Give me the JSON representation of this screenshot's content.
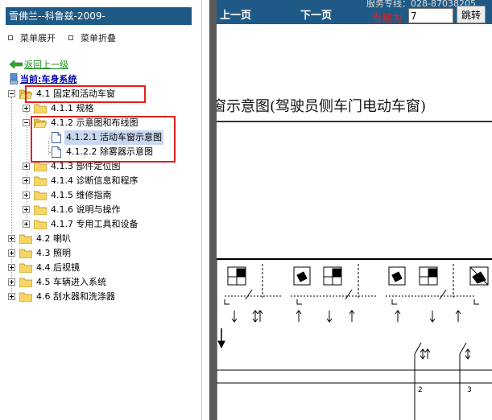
{
  "left_panel": {
    "title": "雪佛兰--科鲁兹-2009-",
    "expand_label": "菜单展开",
    "collapse_label": "菜单折叠",
    "back_label": "返回上一级",
    "current_label": "当前:车身系统",
    "tree": [
      {
        "level": 0,
        "label": "4.1 固定和活动车窗",
        "type": "folder",
        "toggle": "minus"
      },
      {
        "level": 1,
        "label": "4.1.1 规格",
        "type": "folder",
        "toggle": "plus"
      },
      {
        "level": 1,
        "label": "4.1.2 示意图和布线图",
        "type": "folder",
        "toggle": "minus"
      },
      {
        "level": 2,
        "label": "4.1.2.1 活动车窗示意图",
        "type": "doc",
        "selected": true
      },
      {
        "level": 2,
        "label": "4.1.2.2 除雾器示意图",
        "type": "doc"
      },
      {
        "level": 1,
        "label": "4.1.3 部件定位图",
        "type": "folder",
        "toggle": "plus"
      },
      {
        "level": 1,
        "label": "4.1.4 诊断信息和程序",
        "type": "folder",
        "toggle": "plus"
      },
      {
        "level": 1,
        "label": "4.1.5 维修指南",
        "type": "folder",
        "toggle": "plus"
      },
      {
        "level": 1,
        "label": "4.1.6 说明与操作",
        "type": "folder",
        "toggle": "plus"
      },
      {
        "level": 1,
        "label": "4.1.7 专用工具和设备",
        "type": "folder",
        "toggle": "plus"
      },
      {
        "level": 0,
        "label": "4.2 喇叭",
        "type": "folder",
        "toggle": "plus"
      },
      {
        "level": 0,
        "label": "4.3 照明",
        "type": "folder",
        "toggle": "plus"
      },
      {
        "level": 0,
        "label": "4.4 后视镜",
        "type": "folder",
        "toggle": "plus"
      },
      {
        "level": 0,
        "label": "4.5 车辆进入系统",
        "type": "folder",
        "toggle": "plus"
      },
      {
        "level": 0,
        "label": "4.6 刮水器和洗涤器",
        "type": "folder",
        "toggle": "plus"
      }
    ]
  },
  "right_panel": {
    "hotline": "服务专线：028-87038205",
    "prev_label": "上一页",
    "next_label": "下一页",
    "current_page_label": "当前为",
    "page_value": "7",
    "jump_label": "跳转",
    "diagram_title": "窗示意图(驾驶员侧车门电动车窗)",
    "wire_labels": [
      "2",
      "3"
    ]
  },
  "colors": {
    "header_bg": "#1f5a86",
    "highlight_red": "#e02020",
    "back_link": "#1a8c1a",
    "current_link": "#0000aa",
    "selection_bg": "#c8d8f0"
  }
}
